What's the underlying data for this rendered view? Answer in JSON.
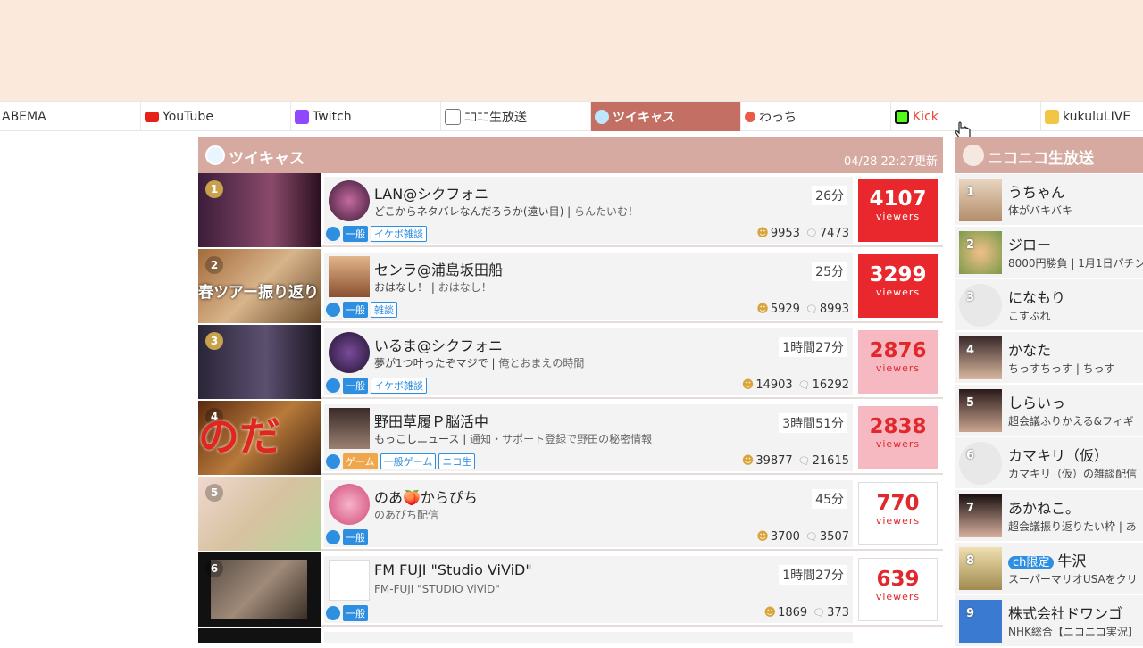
{
  "colors": {
    "accent": "#c46f63",
    "header_bg": "#d6aaa0",
    "top_band": "#fbe9dc",
    "viewer_red": "#e8282d",
    "viewer_pink": "#f6b9c2"
  },
  "tabs": [
    {
      "label": "ABEMA",
      "icon": "abema-icon"
    },
    {
      "label": "YouTube",
      "icon": "youtube-icon"
    },
    {
      "label": "Twitch",
      "icon": "twitch-icon"
    },
    {
      "label": "ﾆｺﾆｺ生放送",
      "icon": "niconico-icon"
    },
    {
      "label": "ツイキャス",
      "icon": "twitcasting-icon",
      "active": true
    },
    {
      "label": "わっち",
      "icon": "wacchi-icon"
    },
    {
      "label": "Kick",
      "icon": "kick-icon"
    },
    {
      "label": "kukuluLIVE",
      "icon": "kukulu-icon"
    }
  ],
  "main": {
    "title": "ツイキャス",
    "updated": "04/28 22:27更新",
    "viewers_label": "viewers",
    "rows": [
      {
        "rank": "1",
        "name": "LAN@シクフォニ",
        "title": "どこからネタバレなんだろうか(遠い目)",
        "subtitle": "らんたいむ！",
        "elapsed": "26分",
        "badge": "一般",
        "tags": [
          "イケボ雑談"
        ],
        "users": "9953",
        "comments": "7473",
        "viewers": "4107"
      },
      {
        "rank": "2",
        "name": "センラ@浦島坂田船",
        "title": "おはなし！",
        "subtitle": "おはなし！",
        "elapsed": "25分",
        "badge": "一般",
        "tags": [
          "雑談"
        ],
        "users": "5929",
        "comments": "8993",
        "viewers": "3299"
      },
      {
        "rank": "3",
        "name": "いるま@シクフォニ",
        "title": "夢が1つ叶ったぞマジで",
        "subtitle": "俺とおまえの時間",
        "elapsed": "1時間27分",
        "badge": "一般",
        "tags": [
          "イケボ雑談"
        ],
        "users": "14903",
        "comments": "16292",
        "viewers": "2876"
      },
      {
        "rank": "4",
        "name": "野田草履Ｐ脳活中",
        "title": "もっこしニュース",
        "subtitle": "通知・サポート登録で野田の秘密情報",
        "elapsed": "3時間51分",
        "badge": "ゲーム",
        "tags": [
          "一般ゲーム",
          "ニコ生"
        ],
        "users": "39877",
        "comments": "21615",
        "viewers": "2838"
      },
      {
        "rank": "5",
        "name": "のあ🍑からぴち",
        "title": "",
        "subtitle": "のあぴち配信",
        "elapsed": "45分",
        "badge": "一般",
        "tags": [],
        "users": "3700",
        "comments": "3507",
        "viewers": "770"
      },
      {
        "rank": "6",
        "name": "FM FUJI \"Studio ViViD\"",
        "title": "",
        "subtitle": "FM-FUJI \"STUDIO ViViD\"",
        "elapsed": "1時間27分",
        "badge": "一般",
        "tags": [],
        "users": "1869",
        "comments": "373",
        "viewers": "639"
      }
    ],
    "thumb_text_2": "春ツアー振り返り",
    "thumb_text_4": "のだ"
  },
  "side": {
    "title": "ニコニコ生放送",
    "rows": [
      {
        "rank": "1",
        "name": "うちゃん",
        "desc": "体がバキバキ"
      },
      {
        "rank": "2",
        "name": "ジロー",
        "desc": "8000円勝負 | 1月1日パチン"
      },
      {
        "rank": "3",
        "name": "になもり",
        "desc": "こすぷれ"
      },
      {
        "rank": "4",
        "name": "かなた",
        "desc": "ちっすちっす | ちっす"
      },
      {
        "rank": "5",
        "name": "しらいっ",
        "desc": "超会議ふりかえる&フィギ"
      },
      {
        "rank": "6",
        "name": "カマキリ（仮）",
        "desc": "カマキリ（仮）の雑談配信"
      },
      {
        "rank": "7",
        "name": "あかねこ。",
        "desc": "超会議振り返りたい枠 | あ"
      },
      {
        "rank": "8",
        "badge": "ch限定",
        "name": "牛沢",
        "desc": "スーパーマリオUSAをクリ"
      },
      {
        "rank": "9",
        "name": "株式会社ドワンゴ",
        "desc": "NHK総合【ニコニコ実況】"
      }
    ]
  }
}
